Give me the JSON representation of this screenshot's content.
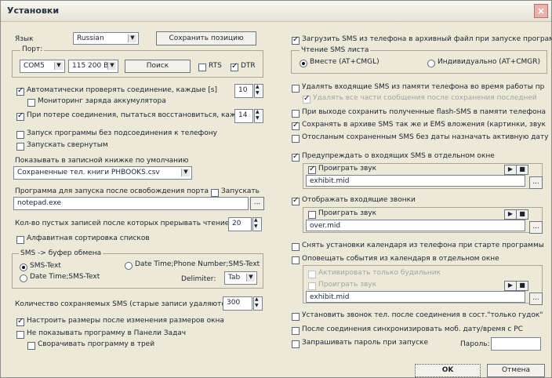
{
  "window": {
    "title": "Установки"
  },
  "left": {
    "language_label": "Язык",
    "language_value": "Russian",
    "save_position": "Сохранить позицию",
    "port_group": "Порт:",
    "port_value": "COM5",
    "baud_value": "115 200 Bd",
    "search_button": "Поиск",
    "rts_label": "RTS",
    "dtr_label": "DTR",
    "auto_check": "Автоматически проверять соединение, каждые [s]",
    "auto_check_value": "10",
    "battery_monitor": "Мониторинг заряда аккумулятора",
    "reconnect": "При потере соединения, пытаться восстановиться, каж",
    "reconnect_value": "14",
    "start_without_phone": "Запуск программы без подсоединения к телефону",
    "start_minimized": "Запускать свернутым",
    "phonebook_label": "Показывать в записной книжке по умолчанию",
    "phonebook_value": "Сохраненные тел. книги PHBOOKS.csv",
    "launch_program_label": "Программа для запуска после освобождения порта",
    "launch_label": "Запускать",
    "launch_value": "notepad.exe",
    "empty_entries_label": "Кол-во пустых записей после которых прерывать чтение",
    "empty_entries_value": "20",
    "alphabetical_sort": "Алфавитная сортировка списков",
    "clipboard_group": "SMS -> буфер обмена",
    "sms_text": "SMS-Text",
    "date_phone_sms": "Date Time;Phone Number;SMS-Text",
    "date_sms": "Date Time;SMS-Text",
    "delimiter_label": "Delimiter:",
    "delimiter_value": "Tab",
    "saved_sms_label": "Количество сохраняемых SMS (старые записи удаляются",
    "saved_sms_value": "300",
    "resize_after_window": "Настроить размеры после изменения размеров окна",
    "hide_taskbar": "Не показывать программу в Панели Задач",
    "minimize_tray": "Сворачивать программу в трей"
  },
  "right": {
    "load_sms_archive": "Загрузить SMS из телефона в архивный файл при запуске программы",
    "read_sms_sheet": "Чтение SMS листа",
    "together": "Вместе (AT+CMGL)",
    "individually": "Индивидуально (AT+CMGR)",
    "delete_incoming": "Удалять входящие SMS из памяти телефона во время работы пр",
    "delete_all_parts": "Удалять все части сообщения после сохранения последней",
    "on_exit_save_flash": "При выходе сохранить полученные flash-SMS в памяти телефона",
    "save_archive_ems": "Сохранять в архиве SMS так же и EMS вложения (картинки, звук",
    "sent_without_date": "Отосланым сохраненным SMS без даты назначать активную дату",
    "notify_sms_window": "Предупреждать о входящих SMS в отдельном окне",
    "play_sound_1": "Проиграть звук",
    "sound_file_1": "exhibit.mid",
    "show_incoming_calls": "Отображать входящие звонки",
    "play_sound_2": "Проиграть звук",
    "sound_file_2": "over.mid",
    "remove_calendar": "Снять установки календаря из телефона при старте программы",
    "calendar_events": "Оповещать события из календаря в отдельном окне",
    "activate_only_alarm": "Активировать только будильник",
    "play_sound_3": "Проиграть звук",
    "sound_file_3": "exhibit.mid",
    "set_ringtone": "Установить звонок тел. после соединения в сост.\"только гудок\"",
    "sync_datetime": "После соединения синхронизировать моб. дату/время с PC",
    "ask_password": "Запрашивать пароль при запуске",
    "password_label": "Пароль:",
    "ok_button": "OK",
    "cancel_button": "Отмена"
  }
}
